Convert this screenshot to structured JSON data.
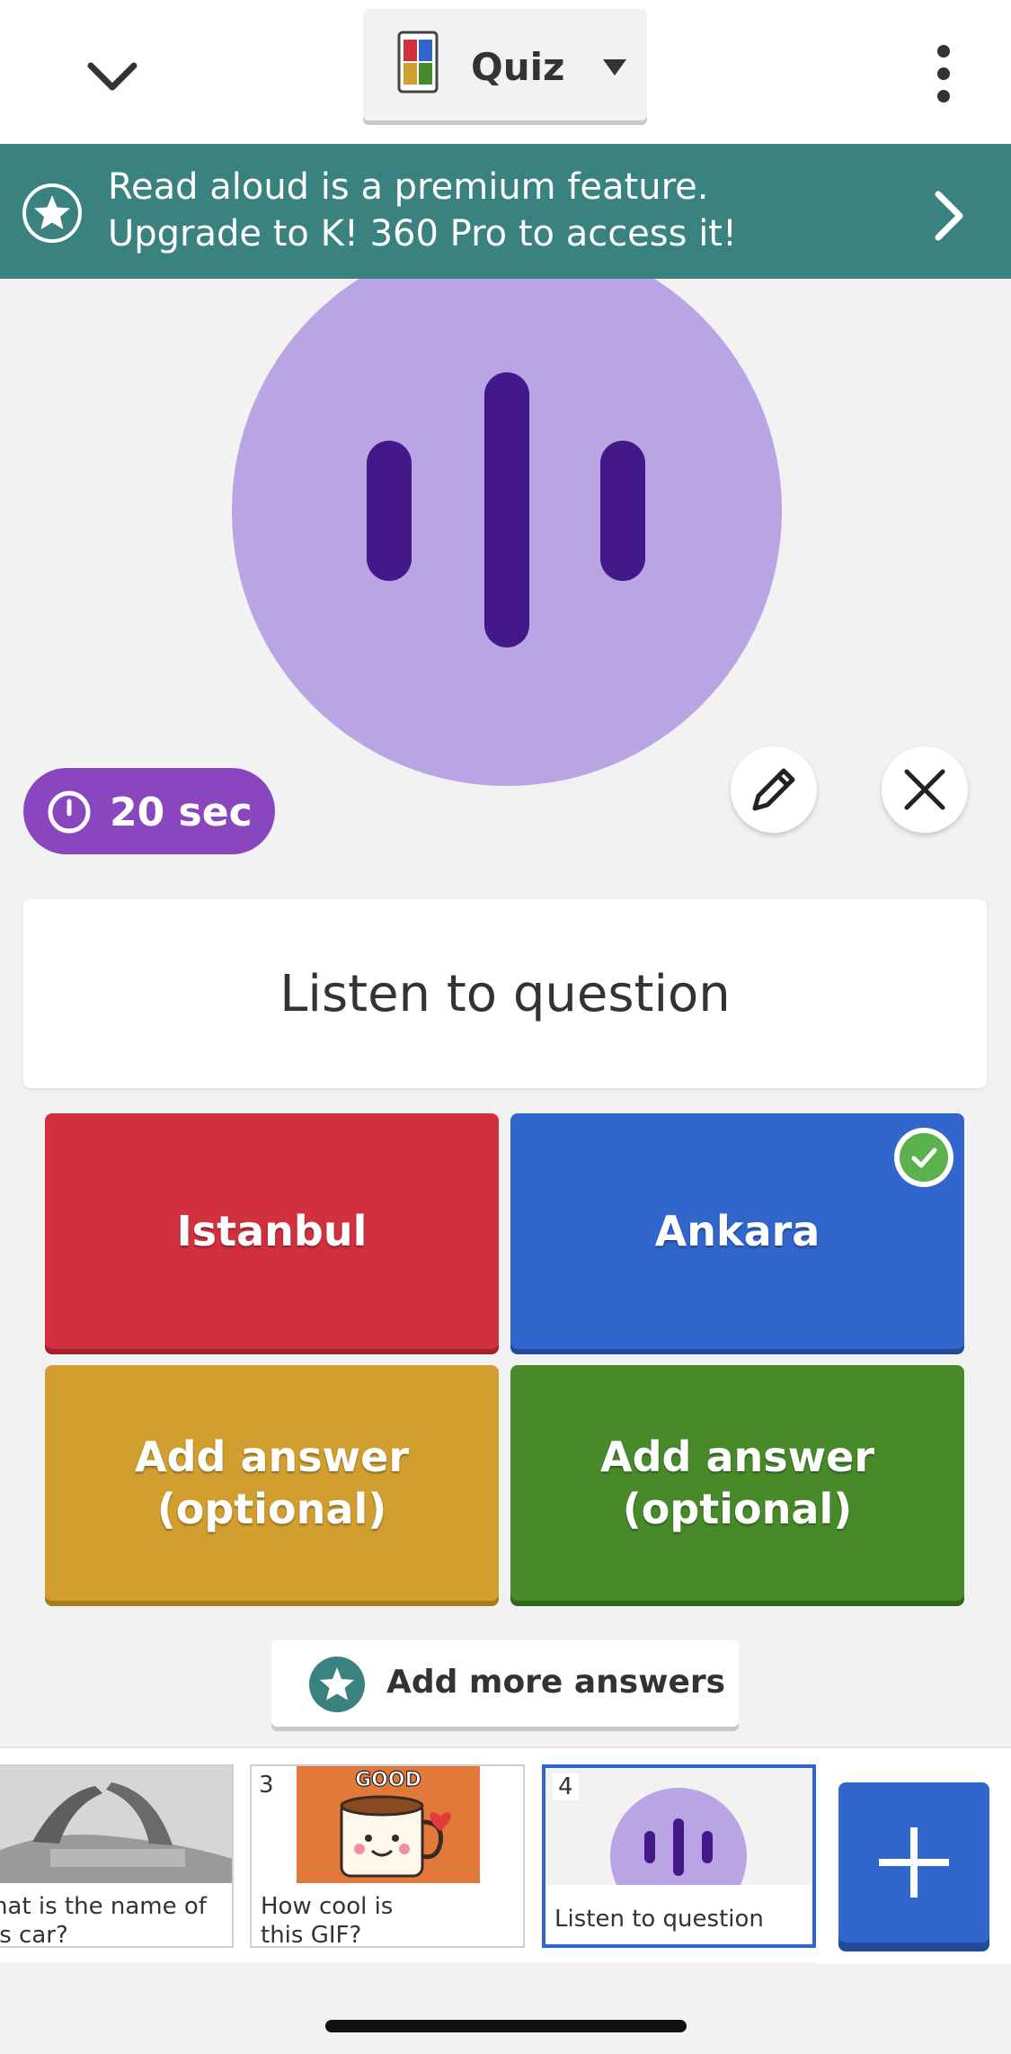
{
  "header": {
    "quiz_type_label": "Quiz"
  },
  "banner": {
    "line1": "Read aloud is a premium feature.",
    "line2": "Upgrade to K! 360 Pro to access it!"
  },
  "timer": {
    "label": "20 sec"
  },
  "question": {
    "text": "Listen to question"
  },
  "answers": [
    {
      "label": "Istanbul",
      "color": "#d1303f",
      "correct": false
    },
    {
      "label": "Ankara",
      "color": "#3166cc",
      "correct": true
    },
    {
      "label": "Add answer\n(optional)",
      "color": "#d09f2f",
      "correct": false
    },
    {
      "label": "Add answer\n(optional)",
      "color": "#488a2a",
      "correct": false
    }
  ],
  "add_more": {
    "label": "Add more answers"
  },
  "slides": [
    {
      "number": "",
      "text": "hat is the name of\nis car?"
    },
    {
      "number": "3",
      "text": "How cool is\nthis GIF?",
      "image_text": "GOOD"
    },
    {
      "number": "4",
      "text": "Listen to question"
    }
  ],
  "colors": {
    "banner": "#3a8280",
    "media_circle": "#b9a4e4",
    "audio_bars": "#43198a",
    "timer": "#8946bf",
    "accent_blue": "#3166cc"
  },
  "icons": {
    "collapse": "chevron-down-icon",
    "more": "more-vertical-icon",
    "premium": "star-icon",
    "banner_go": "chevron-right-icon",
    "timer": "clock-icon",
    "edit": "pencil-icon",
    "remove": "close-icon",
    "correct": "check-icon",
    "add_slide": "plus-icon"
  }
}
